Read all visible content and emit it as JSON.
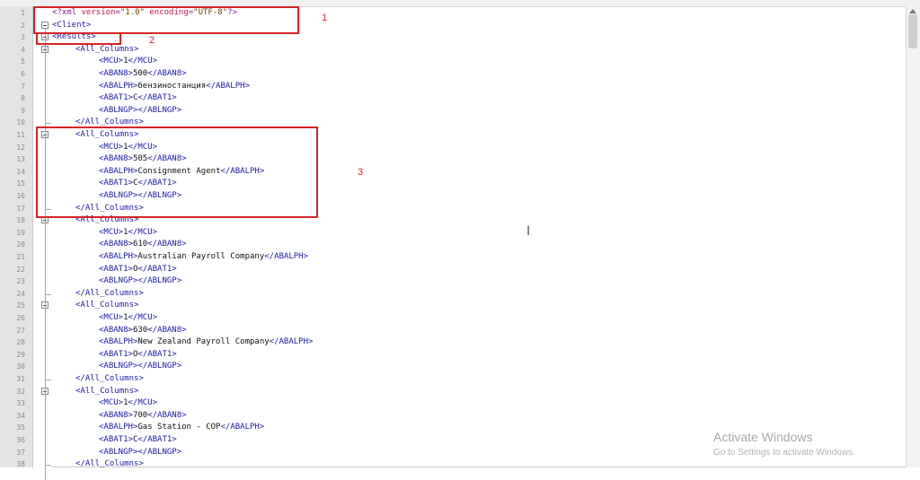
{
  "window": {
    "title": ""
  },
  "editor": {
    "lines": [
      {
        "n": "1",
        "indent": 1,
        "parts": [
          [
            "pi",
            "<?xml "
          ],
          [
            "attr",
            "version"
          ],
          [
            "pi",
            "="
          ],
          [
            "str",
            "\"1.0\""
          ],
          [
            "attr",
            " encoding"
          ],
          [
            "pi",
            "="
          ],
          [
            "str",
            "\"UTF-8\""
          ],
          [
            "pi",
            "?>"
          ]
        ]
      },
      {
        "n": "2",
        "indent": 0,
        "parts": [
          [
            "tag",
            "<Client>"
          ]
        ]
      },
      {
        "n": "3",
        "indent": 0,
        "parts": [
          [
            "tag",
            "<Results>"
          ]
        ]
      },
      {
        "n": "4",
        "indent": 1,
        "parts": [
          [
            "tag",
            "<All_Columns>"
          ]
        ]
      },
      {
        "n": "5",
        "indent": 2,
        "parts": [
          [
            "tag",
            "<MCU>"
          ],
          [
            "text",
            "1"
          ],
          [
            "tag",
            "</MCU>"
          ]
        ]
      },
      {
        "n": "6",
        "indent": 2,
        "parts": [
          [
            "tag",
            "<ABAN8>"
          ],
          [
            "text",
            "500"
          ],
          [
            "tag",
            "</ABAN8>"
          ]
        ]
      },
      {
        "n": "7",
        "indent": 2,
        "parts": [
          [
            "tag",
            "<ABALPH>"
          ],
          [
            "text",
            "бензиностанция"
          ],
          [
            "tag",
            "</ABALPH>"
          ]
        ]
      },
      {
        "n": "8",
        "indent": 2,
        "parts": [
          [
            "tag",
            "<ABAT1>"
          ],
          [
            "text",
            "C"
          ],
          [
            "tag",
            "</ABAT1>"
          ]
        ]
      },
      {
        "n": "9",
        "indent": 2,
        "parts": [
          [
            "tag",
            "<ABLNGP>"
          ],
          [
            "tag",
            "</ABLNGP>"
          ]
        ]
      },
      {
        "n": "10",
        "indent": 1,
        "parts": [
          [
            "tag",
            "</All_Columns>"
          ]
        ]
      },
      {
        "n": "11",
        "indent": 1,
        "parts": [
          [
            "tag",
            "<All_Columns>"
          ]
        ]
      },
      {
        "n": "12",
        "indent": 2,
        "parts": [
          [
            "tag",
            "<MCU>"
          ],
          [
            "text",
            "1"
          ],
          [
            "tag",
            "</MCU>"
          ]
        ]
      },
      {
        "n": "13",
        "indent": 2,
        "parts": [
          [
            "tag",
            "<ABAN8>"
          ],
          [
            "text",
            "505"
          ],
          [
            "tag",
            "</ABAN8>"
          ]
        ]
      },
      {
        "n": "14",
        "indent": 2,
        "parts": [
          [
            "tag",
            "<ABALPH>"
          ],
          [
            "text",
            "Consignment Agent"
          ],
          [
            "tag",
            "</ABALPH>"
          ]
        ]
      },
      {
        "n": "15",
        "indent": 2,
        "parts": [
          [
            "tag",
            "<ABAT1>"
          ],
          [
            "text",
            "C"
          ],
          [
            "tag",
            "</ABAT1>"
          ]
        ]
      },
      {
        "n": "16",
        "indent": 2,
        "parts": [
          [
            "tag",
            "<ABLNGP>"
          ],
          [
            "tag",
            "</ABLNGP>"
          ]
        ]
      },
      {
        "n": "17",
        "indent": 1,
        "parts": [
          [
            "tag",
            "</All_Columns>"
          ]
        ]
      },
      {
        "n": "18",
        "indent": 1,
        "parts": [
          [
            "tag",
            "<All_Columns>"
          ]
        ]
      },
      {
        "n": "19",
        "indent": 2,
        "parts": [
          [
            "tag",
            "<MCU>"
          ],
          [
            "text",
            "1"
          ],
          [
            "tag",
            "</MCU>"
          ]
        ]
      },
      {
        "n": "20",
        "indent": 2,
        "parts": [
          [
            "tag",
            "<ABAN8>"
          ],
          [
            "text",
            "610"
          ],
          [
            "tag",
            "</ABAN8>"
          ]
        ]
      },
      {
        "n": "21",
        "indent": 2,
        "parts": [
          [
            "tag",
            "<ABALPH>"
          ],
          [
            "text",
            "Australian Payroll Company"
          ],
          [
            "tag",
            "</ABALPH>"
          ]
        ]
      },
      {
        "n": "22",
        "indent": 2,
        "parts": [
          [
            "tag",
            "<ABAT1>"
          ],
          [
            "text",
            "O"
          ],
          [
            "tag",
            "</ABAT1>"
          ]
        ]
      },
      {
        "n": "23",
        "indent": 2,
        "parts": [
          [
            "tag",
            "<ABLNGP>"
          ],
          [
            "tag",
            "</ABLNGP>"
          ]
        ]
      },
      {
        "n": "24",
        "indent": 1,
        "parts": [
          [
            "tag",
            "</All_Columns>"
          ]
        ]
      },
      {
        "n": "25",
        "indent": 1,
        "parts": [
          [
            "tag",
            "<All_Columns>"
          ]
        ]
      },
      {
        "n": "26",
        "indent": 2,
        "parts": [
          [
            "tag",
            "<MCU>"
          ],
          [
            "text",
            "1"
          ],
          [
            "tag",
            "</MCU>"
          ]
        ]
      },
      {
        "n": "27",
        "indent": 2,
        "parts": [
          [
            "tag",
            "<ABAN8>"
          ],
          [
            "text",
            "630"
          ],
          [
            "tag",
            "</ABAN8>"
          ]
        ]
      },
      {
        "n": "28",
        "indent": 2,
        "parts": [
          [
            "tag",
            "<ABALPH>"
          ],
          [
            "text",
            "New Zealand Payroll Company"
          ],
          [
            "tag",
            "</ABALPH>"
          ]
        ]
      },
      {
        "n": "29",
        "indent": 2,
        "parts": [
          [
            "tag",
            "<ABAT1>"
          ],
          [
            "text",
            "O"
          ],
          [
            "tag",
            "</ABAT1>"
          ]
        ]
      },
      {
        "n": "30",
        "indent": 2,
        "parts": [
          [
            "tag",
            "<ABLNGP>"
          ],
          [
            "tag",
            "</ABLNGP>"
          ]
        ]
      },
      {
        "n": "31",
        "indent": 1,
        "parts": [
          [
            "tag",
            "</All_Columns>"
          ]
        ]
      },
      {
        "n": "32",
        "indent": 1,
        "parts": [
          [
            "tag",
            "<All_Columns>"
          ]
        ]
      },
      {
        "n": "33",
        "indent": 2,
        "parts": [
          [
            "tag",
            "<MCU>"
          ],
          [
            "text",
            "1"
          ],
          [
            "tag",
            "</MCU>"
          ]
        ]
      },
      {
        "n": "34",
        "indent": 2,
        "parts": [
          [
            "tag",
            "<ABAN8>"
          ],
          [
            "text",
            "700"
          ],
          [
            "tag",
            "</ABAN8>"
          ]
        ]
      },
      {
        "n": "35",
        "indent": 2,
        "parts": [
          [
            "tag",
            "<ABALPH>"
          ],
          [
            "text",
            "Gas Station - COP"
          ],
          [
            "tag",
            "</ABALPH>"
          ]
        ]
      },
      {
        "n": "36",
        "indent": 2,
        "parts": [
          [
            "tag",
            "<ABAT1>"
          ],
          [
            "text",
            "C"
          ],
          [
            "tag",
            "</ABAT1>"
          ]
        ]
      },
      {
        "n": "37",
        "indent": 2,
        "parts": [
          [
            "tag",
            "<ABLNGP>"
          ],
          [
            "tag",
            "</ABLNGP>"
          ]
        ]
      },
      {
        "n": "38",
        "indent": 1,
        "parts": [
          [
            "tag",
            "</All_Columns>"
          ]
        ]
      }
    ]
  },
  "annotations": {
    "label_1": "1",
    "label_2": "2",
    "label_3": "3",
    "color": "#d62424"
  },
  "overlay": {
    "watermark_title": "Activate Windows",
    "watermark_sub": "Go to Settings to activate Windows."
  },
  "colors": {
    "tag": "#1a1aa6",
    "processing_instruction": "#8b1f8b",
    "attribute": "#c2185b",
    "string": "#7a3e00"
  },
  "icons": [
    "fold-minus-icon",
    "text-cursor-icon",
    "scroll-up-arrow-icon"
  ]
}
